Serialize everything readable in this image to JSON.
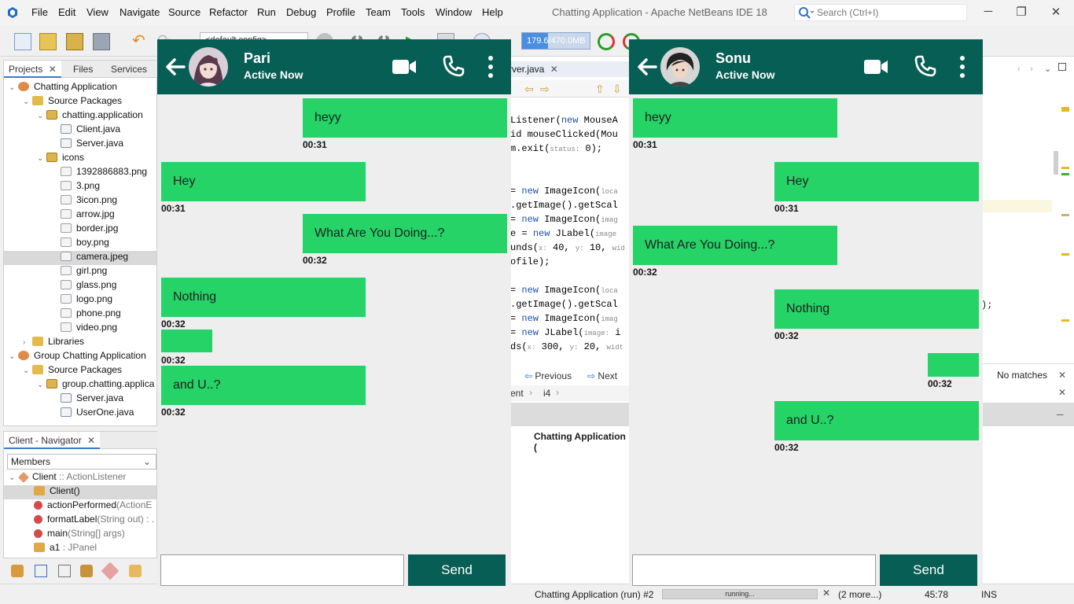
{
  "window": {
    "title": "Chatting Application - Apache NetBeans IDE 18",
    "menu": [
      "File",
      "Edit",
      "View",
      "Navigate",
      "Source",
      "Refactor",
      "Run",
      "Debug",
      "Profile",
      "Team",
      "Tools",
      "Window",
      "Help"
    ],
    "search_placeholder": "Search (Ctrl+I)"
  },
  "toolbar": {
    "config": "<default config>",
    "memory": "179.6/470.0MB",
    "memory_fraction": 0.38
  },
  "projects": {
    "tabs": [
      "Projects",
      "Files",
      "Services"
    ],
    "tree": [
      {
        "label": "Chatting Application",
        "depth": 0,
        "icon": "project-icon",
        "chev": "open"
      },
      {
        "label": "Source Packages",
        "depth": 1,
        "icon": "folder-icon",
        "chev": "open"
      },
      {
        "label": "chatting.application",
        "depth": 2,
        "icon": "package-icon",
        "chev": "open"
      },
      {
        "label": "Client.java",
        "depth": 3,
        "icon": "java-file-icon",
        "chev": ""
      },
      {
        "label": "Server.java",
        "depth": 3,
        "icon": "java-file-icon",
        "chev": ""
      },
      {
        "label": "icons",
        "depth": 2,
        "icon": "package-icon",
        "chev": "open"
      },
      {
        "label": "1392886883.png",
        "depth": 3,
        "icon": "image-file-icon",
        "chev": ""
      },
      {
        "label": "3.png",
        "depth": 3,
        "icon": "image-file-icon",
        "chev": ""
      },
      {
        "label": "3icon.png",
        "depth": 3,
        "icon": "image-file-icon",
        "chev": ""
      },
      {
        "label": "arrow.jpg",
        "depth": 3,
        "icon": "image-file-icon",
        "chev": ""
      },
      {
        "label": "border.jpg",
        "depth": 3,
        "icon": "image-file-icon",
        "chev": ""
      },
      {
        "label": "boy.png",
        "depth": 3,
        "icon": "image-file-icon",
        "chev": ""
      },
      {
        "label": "camera.jpeg",
        "depth": 3,
        "icon": "image-file-icon",
        "chev": "",
        "selected": true
      },
      {
        "label": "girl.png",
        "depth": 3,
        "icon": "image-file-icon",
        "chev": ""
      },
      {
        "label": "glass.png",
        "depth": 3,
        "icon": "image-file-icon",
        "chev": ""
      },
      {
        "label": "logo.png",
        "depth": 3,
        "icon": "image-file-icon",
        "chev": ""
      },
      {
        "label": "phone.png",
        "depth": 3,
        "icon": "image-file-icon",
        "chev": ""
      },
      {
        "label": "video.png",
        "depth": 3,
        "icon": "image-file-icon",
        "chev": ""
      },
      {
        "label": "Libraries",
        "depth": 1,
        "icon": "folder-icon",
        "chev": "closed"
      },
      {
        "label": "Group Chatting Application",
        "depth": 0,
        "icon": "project-icon",
        "chev": "open"
      },
      {
        "label": "Source Packages",
        "depth": 1,
        "icon": "folder-icon",
        "chev": "open"
      },
      {
        "label": "group.chatting.applica",
        "depth": 2,
        "icon": "package-icon",
        "chev": "open"
      },
      {
        "label": "Server.java",
        "depth": 3,
        "icon": "java-file-icon",
        "chev": ""
      },
      {
        "label": "UserOne.java",
        "depth": 3,
        "icon": "java-file-icon",
        "chev": ""
      }
    ]
  },
  "navigator": {
    "title": "Client - Navigator",
    "filter": "Members",
    "items": [
      {
        "label": "Client",
        "suffix": " :: ActionListener",
        "depth": 0,
        "icon": "class-icon"
      },
      {
        "label": "Client()",
        "suffix": "",
        "depth": 1,
        "icon": "constructor-icon",
        "selected": true
      },
      {
        "label": "actionPerformed",
        "suffix": "(ActionE",
        "depth": 1,
        "icon": "method-icon"
      },
      {
        "label": "formatLabel",
        "suffix": "(String out) : .",
        "depth": 1,
        "icon": "method-icon"
      },
      {
        "label": "main",
        "suffix": "(String[] args)",
        "depth": 1,
        "icon": "method-icon"
      },
      {
        "label": "a1",
        "suffix": " : JPanel",
        "depth": 1,
        "icon": "field-icon"
      }
    ]
  },
  "editor": {
    "tab": "rver.java",
    "lines": [
      {
        "t": "Listener(<k>new</k> MouseA"
      },
      {
        "t": "id mouseClicked(Mou"
      },
      {
        "t": "m.exit(<h>status:</h> 0);"
      },
      {
        "t": ""
      },
      {
        "t": ""
      },
      {
        "t": "= <k>new</k> ImageIcon(<h>loca</h>"
      },
      {
        "t": ".getImage().getScal"
      },
      {
        "t": "= <k>new</k> ImageIcon(<h>imag</h>"
      },
      {
        "t": "e = <k>new</k> JLabel(<h>image</h>"
      },
      {
        "t": "unds(<h>x:</h> 40, <h>y:</h> 10, <h>wid</h>"
      },
      {
        "t": "ofile);"
      },
      {
        "t": ""
      },
      {
        "t": "= <k>new</k> ImageIcon(<h>loca</h>"
      },
      {
        "t": ".getImage().getScal"
      },
      {
        "t": "= <k>new</k> ImageIcon(<h>imag</h>"
      },
      {
        "t": "= <k>new</k> JLabel(<h>image:</h> i"
      },
      {
        "t": "ds(<h>x:</h> 300, <h>y:</h> 20, <h>widt</h>"
      }
    ],
    "find_prev": "Previous",
    "find_next": "Next",
    "crumb1": "ent",
    "crumb2": "i4",
    "output_tab": "Chatting Application ("
  },
  "right_panel": {
    "no_matches": "No matches",
    "code_tail": ");"
  },
  "status": {
    "run_label": "Chatting Application (run) #2",
    "progress": "running...",
    "more": "(2 more...)",
    "position": "45:78",
    "mode": "INS"
  },
  "chats": {
    "left": {
      "name": "Pari",
      "status": "Active Now",
      "send": "Send",
      "input_value": "",
      "messages": [
        {
          "text": "heyy",
          "time": "00:31",
          "side": "right"
        },
        {
          "text": "Hey",
          "time": "00:31",
          "side": "left"
        },
        {
          "text": "What Are You Doing...?",
          "time": "00:32",
          "side": "right"
        },
        {
          "text": "Nothing",
          "time": "00:32",
          "side": "left"
        },
        {
          "text": "",
          "time": "00:32",
          "side": "left"
        },
        {
          "text": "and U..?",
          "time": "00:32",
          "side": "left"
        }
      ]
    },
    "right": {
      "name": "Sonu",
      "status": "Active Now",
      "send": "Send",
      "input_value": "",
      "messages": [
        {
          "text": "heyy",
          "time": "00:31",
          "side": "left"
        },
        {
          "text": "Hey",
          "time": "00:31",
          "side": "right"
        },
        {
          "text": "What Are You Doing...?",
          "time": "00:32",
          "side": "left"
        },
        {
          "text": "Nothing",
          "time": "00:32",
          "side": "right"
        },
        {
          "text": "",
          "time": "00:32",
          "side": "right"
        },
        {
          "text": "and U..?",
          "time": "00:32",
          "side": "right"
        }
      ]
    }
  },
  "colors": {
    "chat_header": "#075e54",
    "bubble": "#25d366",
    "send_button": "#075e54"
  }
}
